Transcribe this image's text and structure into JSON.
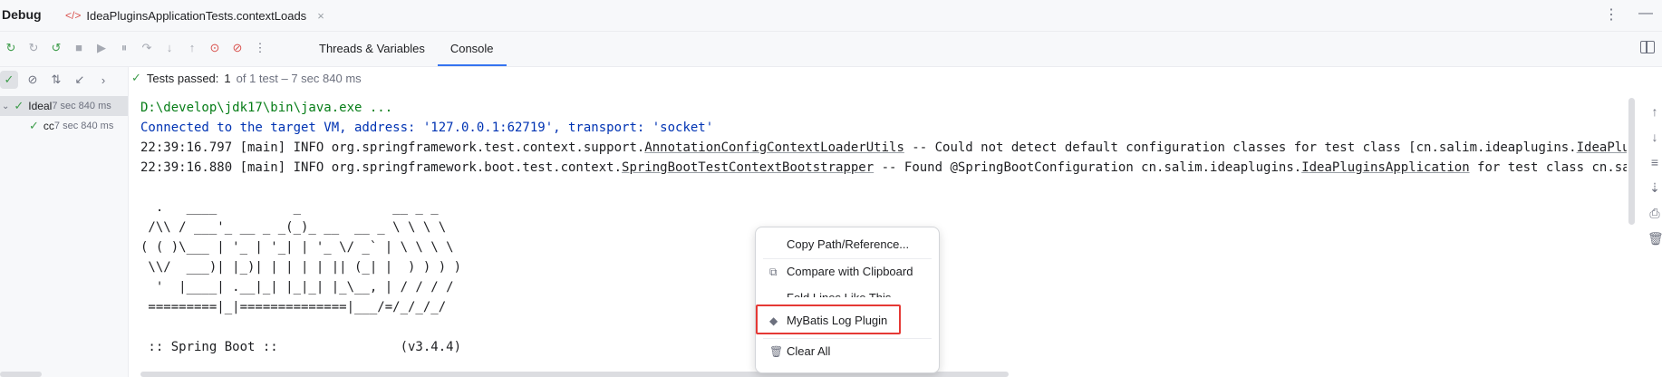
{
  "title_bar": {
    "title": "Debug",
    "tab": "IdeaPluginsApplicationTests.contextLoads",
    "tab_close": "×",
    "more_icon": "⋮",
    "minimize_icon": "—"
  },
  "toolbar": {
    "tabs": [
      "Threads & Variables",
      "Console"
    ],
    "active_tab": "Console",
    "more_icon": "⋮"
  },
  "test_status": {
    "label": "Tests passed:",
    "count": "1",
    "detail": "of 1 test – 7 sec 840 ms"
  },
  "test_tree": {
    "rows": [
      {
        "label": "Ideal",
        "duration": "7 sec 840 ms"
      },
      {
        "label": "cc",
        "duration": "7 sec 840 ms"
      }
    ]
  },
  "console": {
    "cmd": "D:\\develop\\jdk17\\bin\\java.exe ...",
    "connected": "Connected to the target VM, address: '127.0.0.1:62719', transport: 'socket'",
    "log1": {
      "prefix": "22:39:16.797 [main] INFO org.springframework.test.context.support.",
      "link": "AnnotationConfigContextLoaderUtils",
      "middle": " -- Could not detect default configuration classes for test class [cn.salim.ideaplugins.",
      "link2": "IdeaPluginsApplic"
    },
    "log2": {
      "prefix": "22:39:16.880 [main] INFO org.springframework.boot.test.context.",
      "link": "SpringBootTestContextBootstrapper",
      "middle": " -- Found @SpringBootConfiguration cn.salim.ideaplugins.",
      "link2": "IdeaPluginsApplication",
      "suffix": " for test class cn.salim.ideap"
    },
    "banner": [
      "  .   ____          _            __ _ _",
      " /\\\\ / ___'_ __ _ _(_)_ __  __ _ \\ \\ \\ \\",
      "( ( )\\___ | '_ | '_| | '_ \\/ _` | \\ \\ \\ \\",
      " \\\\/  ___)| |_)| | | | | || (_| |  ) ) ) )",
      "  '  |____| .__|_| |_|_| |_\\__, | / / / /",
      " =========|_|==============|___/=/_/_/_/"
    ],
    "spring_boot": " :: Spring Boot ::                (v3.4.4)"
  },
  "context_menu": {
    "items": [
      {
        "label": "Copy Path/Reference...",
        "icon": ""
      },
      {
        "label": "Compare with Clipboard",
        "icon": "compare-icon"
      },
      {
        "label": "Fold Lines Like This",
        "icon": ""
      },
      {
        "label": "MyBatis Log Plugin",
        "icon": "mybatis-bird-icon"
      },
      {
        "label": "Clear All",
        "icon": "trash-icon"
      }
    ]
  },
  "colors": {
    "highlight_border": "#e53935",
    "accent": "#3574f0",
    "success": "#3e9c4b"
  }
}
